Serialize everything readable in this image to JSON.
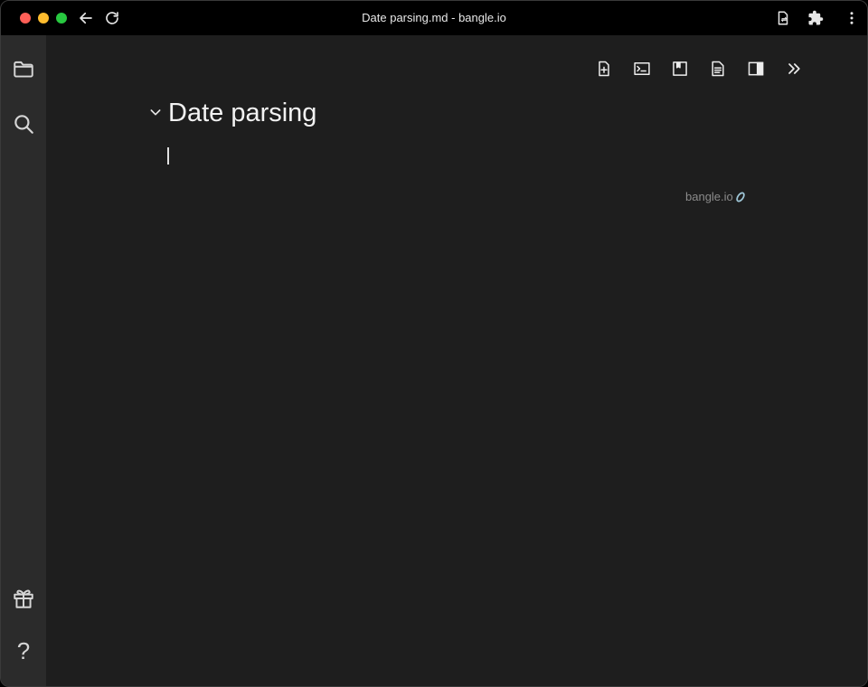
{
  "window": {
    "title": "Date parsing.md - bangle.io"
  },
  "titlebar": {
    "icons": [
      "back-arrow-icon",
      "reload-icon",
      "page-phone-icon",
      "extensions-icon",
      "kebab-menu-icon"
    ]
  },
  "sidebar": {
    "top_items": [
      {
        "icon": "folder-icon",
        "label": "Files"
      },
      {
        "icon": "search-icon",
        "label": "Search"
      }
    ],
    "bottom_items": [
      {
        "icon": "gift-icon",
        "label": "What's new"
      },
      {
        "icon": "help-icon",
        "glyph": "?"
      }
    ]
  },
  "toolbar": {
    "icons": [
      "new-note-icon",
      "terminal-icon",
      "bookmark-icon",
      "document-icon",
      "sidebar-toggle-icon",
      "double-chevron-right-icon"
    ]
  },
  "editor": {
    "heading": "Date parsing",
    "body": ""
  },
  "watermark": {
    "text": "bangle.io"
  },
  "colors": {
    "titlebar": "#000000",
    "sidebar": "#2b2b2b",
    "editor": "#1e1e1e",
    "text": "#f2f2f2",
    "watermark": "#8b8b8b",
    "close": "#ff5f57",
    "minimize": "#febc2e",
    "maximize": "#28c840"
  }
}
